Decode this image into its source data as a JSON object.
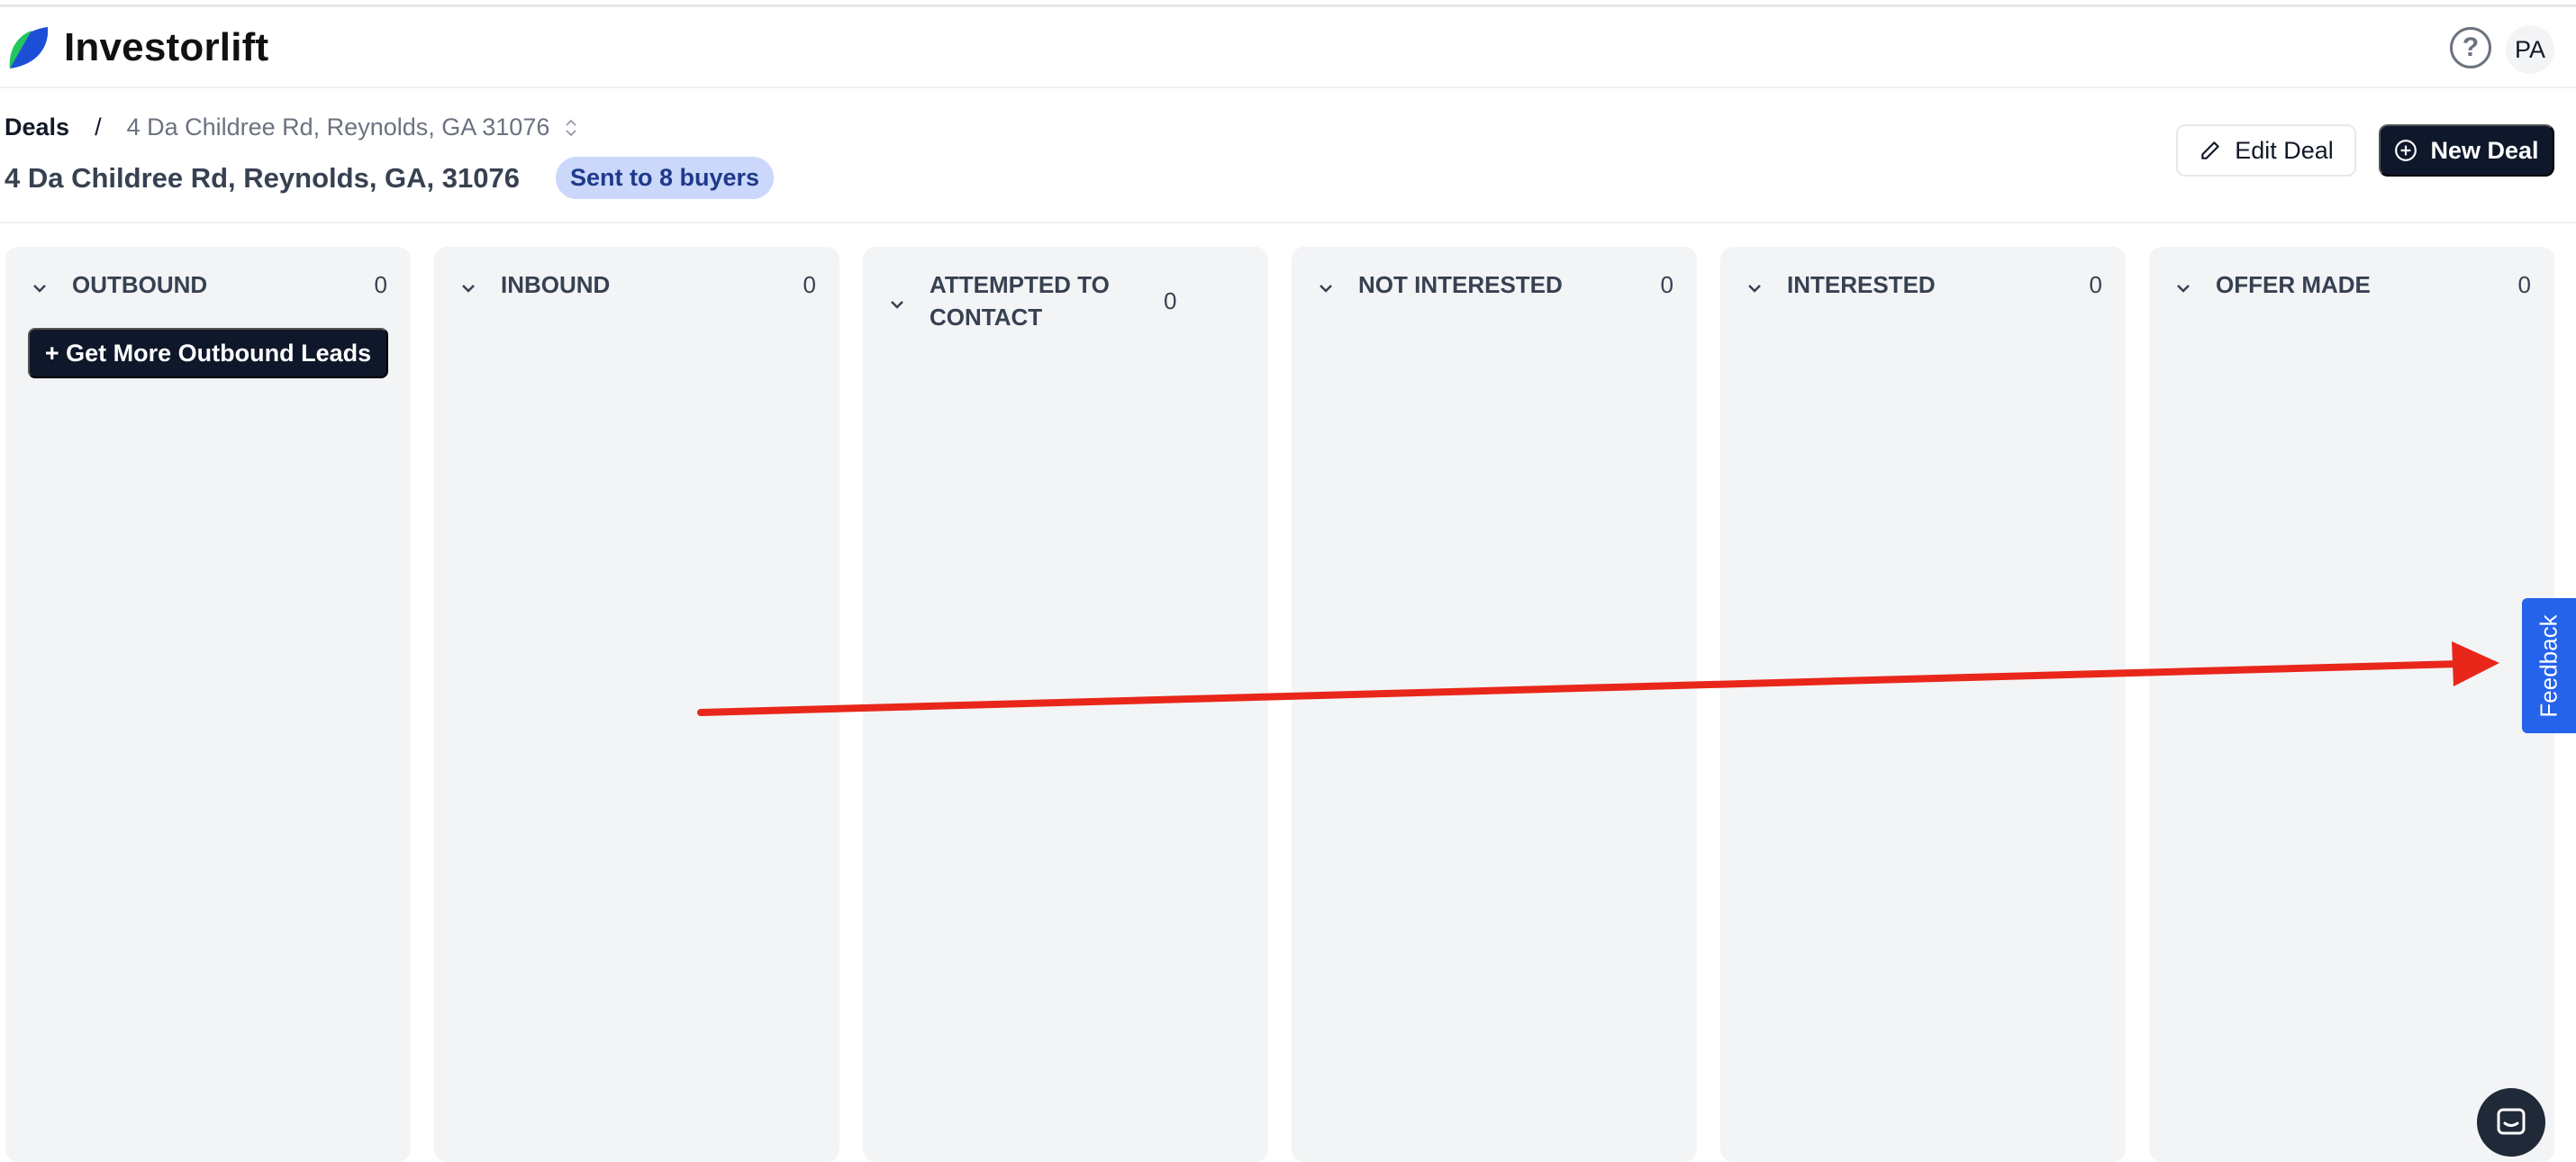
{
  "app": {
    "name": "Investorlift"
  },
  "header": {
    "help_icon": "question-circle-icon",
    "avatar_initials": "PA"
  },
  "breadcrumb": {
    "root": "Deals",
    "separator": "/",
    "current": "4 Da Childree Rd, Reynolds, GA 31076"
  },
  "deal": {
    "title": "4 Da Childree Rd, Reynolds, GA, 31076",
    "status": "Sent to 8 buyers"
  },
  "actions": {
    "edit_label": "Edit Deal",
    "new_label": "New Deal"
  },
  "columns": [
    {
      "title": "OUTBOUND",
      "count": "0",
      "button": "+ Get More Outbound Leads"
    },
    {
      "title": "INBOUND",
      "count": "0"
    },
    {
      "title": "ATTEMPTED TO CONTACT",
      "count": "0"
    },
    {
      "title": "NOT INTERESTED",
      "count": "0"
    },
    {
      "title": "INTERESTED",
      "count": "0"
    },
    {
      "title": "OFFER MADE",
      "count": "0"
    }
  ],
  "feedback": {
    "label": "Feedback"
  },
  "colors": {
    "accent": "#2563eb",
    "dark": "#0f172a",
    "badge_bg": "#cbd7fb",
    "column_bg": "#f3f4f6",
    "arrow": "#e8271a"
  }
}
